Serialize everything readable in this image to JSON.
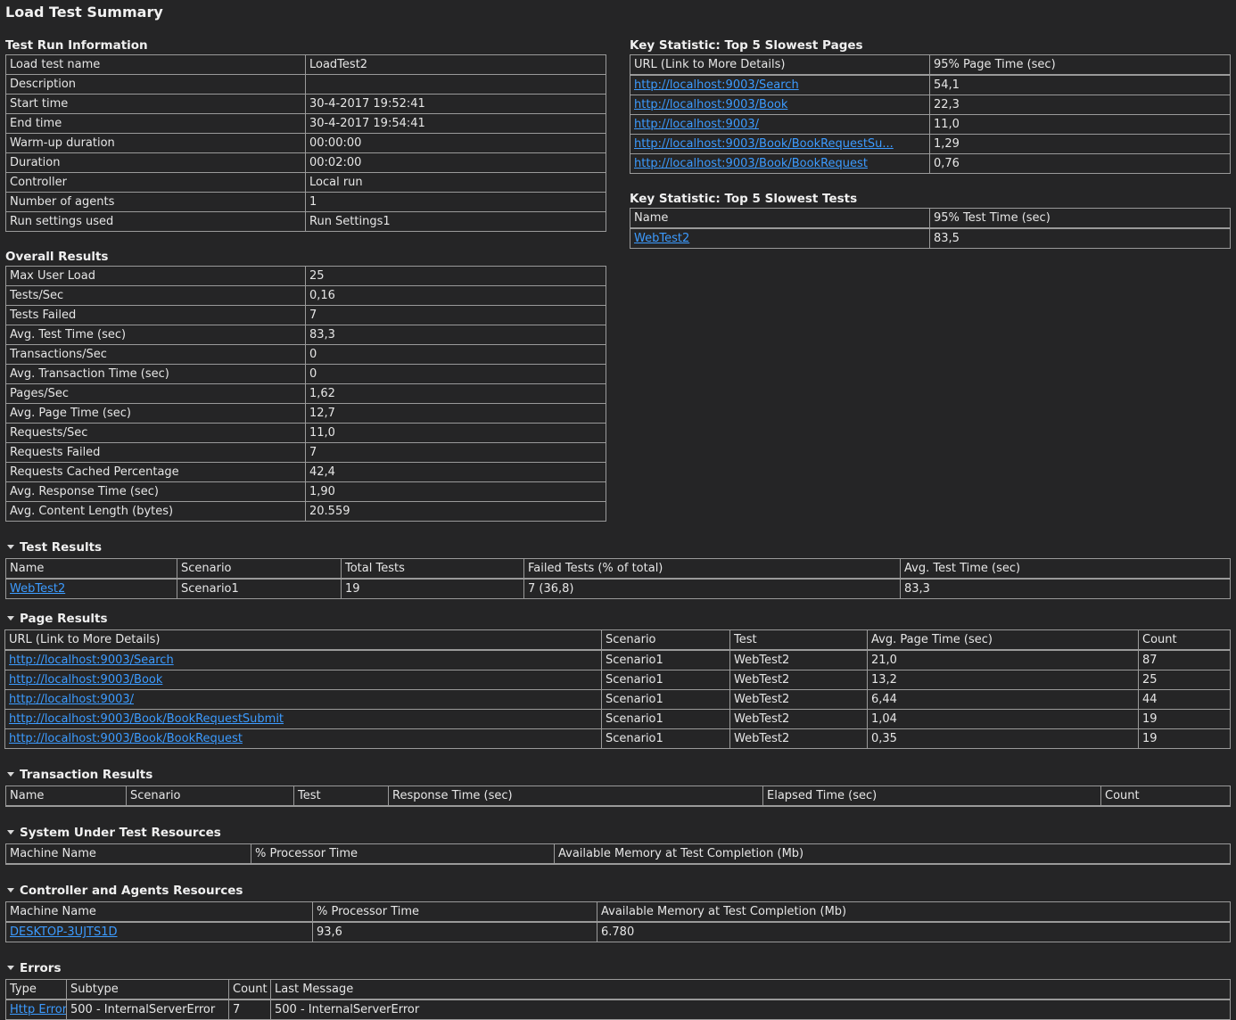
{
  "page_title": "Load Test Summary",
  "run_info": {
    "title": "Test Run Information",
    "rows": [
      [
        "Load test name",
        "LoadTest2"
      ],
      [
        "Description",
        ""
      ],
      [
        "Start time",
        "30-4-2017 19:52:41"
      ],
      [
        "End time",
        "30-4-2017 19:54:41"
      ],
      [
        "Warm-up duration",
        "00:00:00"
      ],
      [
        "Duration",
        "00:02:00"
      ],
      [
        "Controller",
        "Local run"
      ],
      [
        "Number of agents",
        "1"
      ],
      [
        "Run settings used",
        "Run Settings1"
      ]
    ]
  },
  "overall": {
    "title": "Overall Results",
    "rows": [
      [
        "Max User Load",
        "25"
      ],
      [
        "Tests/Sec",
        "0,16"
      ],
      [
        "Tests Failed",
        "7"
      ],
      [
        "Avg. Test Time (sec)",
        "83,3"
      ],
      [
        "Transactions/Sec",
        "0"
      ],
      [
        "Avg. Transaction Time (sec)",
        "0"
      ],
      [
        "Pages/Sec",
        "1,62"
      ],
      [
        "Avg. Page Time (sec)",
        "12,7"
      ],
      [
        "Requests/Sec",
        "11,0"
      ],
      [
        "Requests Failed",
        "7"
      ],
      [
        "Requests Cached Percentage",
        "42,4"
      ],
      [
        "Avg. Response Time (sec)",
        "1,90"
      ],
      [
        "Avg. Content Length (bytes)",
        "20.559"
      ]
    ]
  },
  "slowest_pages": {
    "title": "Key Statistic: Top 5 Slowest Pages",
    "headers": [
      "URL (Link to More Details)",
      "95% Page Time (sec)"
    ],
    "rows": [
      [
        "http://localhost:9003/Search",
        "54,1"
      ],
      [
        "http://localhost:9003/Book",
        "22,3"
      ],
      [
        "http://localhost:9003/",
        "11,0"
      ],
      [
        "http://localhost:9003/Book/BookRequestSu...",
        "1,29"
      ],
      [
        "http://localhost:9003/Book/BookRequest",
        "0,76"
      ]
    ]
  },
  "slowest_tests": {
    "title": "Key Statistic: Top 5 Slowest Tests",
    "headers": [
      "Name",
      "95% Test Time (sec)"
    ],
    "rows": [
      [
        "WebTest2",
        "83,5"
      ]
    ]
  },
  "test_results": {
    "title": "Test Results",
    "headers": [
      "Name",
      "Scenario",
      "Total Tests",
      "Failed Tests (% of total)",
      "Avg. Test Time (sec)"
    ],
    "rows": [
      [
        "WebTest2",
        "Scenario1",
        "19",
        "7 (36,8)",
        "83,3"
      ]
    ]
  },
  "page_results": {
    "title": "Page Results",
    "headers": [
      "URL (Link to More Details)",
      "Scenario",
      "Test",
      "Avg. Page Time (sec)",
      "Count"
    ],
    "rows": [
      [
        "http://localhost:9003/Search",
        "Scenario1",
        "WebTest2",
        "21,0",
        "87"
      ],
      [
        "http://localhost:9003/Book",
        "Scenario1",
        "WebTest2",
        "13,2",
        "25"
      ],
      [
        "http://localhost:9003/",
        "Scenario1",
        "WebTest2",
        "6,44",
        "44"
      ],
      [
        "http://localhost:9003/Book/BookRequestSubmit",
        "Scenario1",
        "WebTest2",
        "1,04",
        "19"
      ],
      [
        "http://localhost:9003/Book/BookRequest",
        "Scenario1",
        "WebTest2",
        "0,35",
        "19"
      ]
    ]
  },
  "transaction_results": {
    "title": "Transaction Results",
    "headers": [
      "Name",
      "Scenario",
      "Test",
      "Response Time (sec)",
      "Elapsed Time (sec)",
      "Count"
    ]
  },
  "sut_resources": {
    "title": "System Under Test Resources",
    "headers": [
      "Machine Name",
      "% Processor Time",
      "Available Memory at Test Completion (Mb)"
    ]
  },
  "controller_resources": {
    "title": "Controller and Agents Resources",
    "headers": [
      "Machine Name",
      "% Processor Time",
      "Available Memory at Test Completion (Mb)"
    ],
    "rows": [
      [
        "DESKTOP-3UJTS1D",
        "93,6",
        "6.780"
      ]
    ]
  },
  "errors": {
    "title": "Errors",
    "headers": [
      "Type",
      "Subtype",
      "Count",
      "Last Message"
    ],
    "rows": [
      [
        "Http Error",
        "500 - InternalServerError",
        "7",
        "500 - InternalServerError"
      ]
    ]
  },
  "colors": {
    "background": "#252526",
    "text": "#e6e6e6",
    "link": "#3c9bff",
    "border": "#9a9a9a"
  },
  "icons": {
    "section_toggle": "caret-down-icon"
  }
}
